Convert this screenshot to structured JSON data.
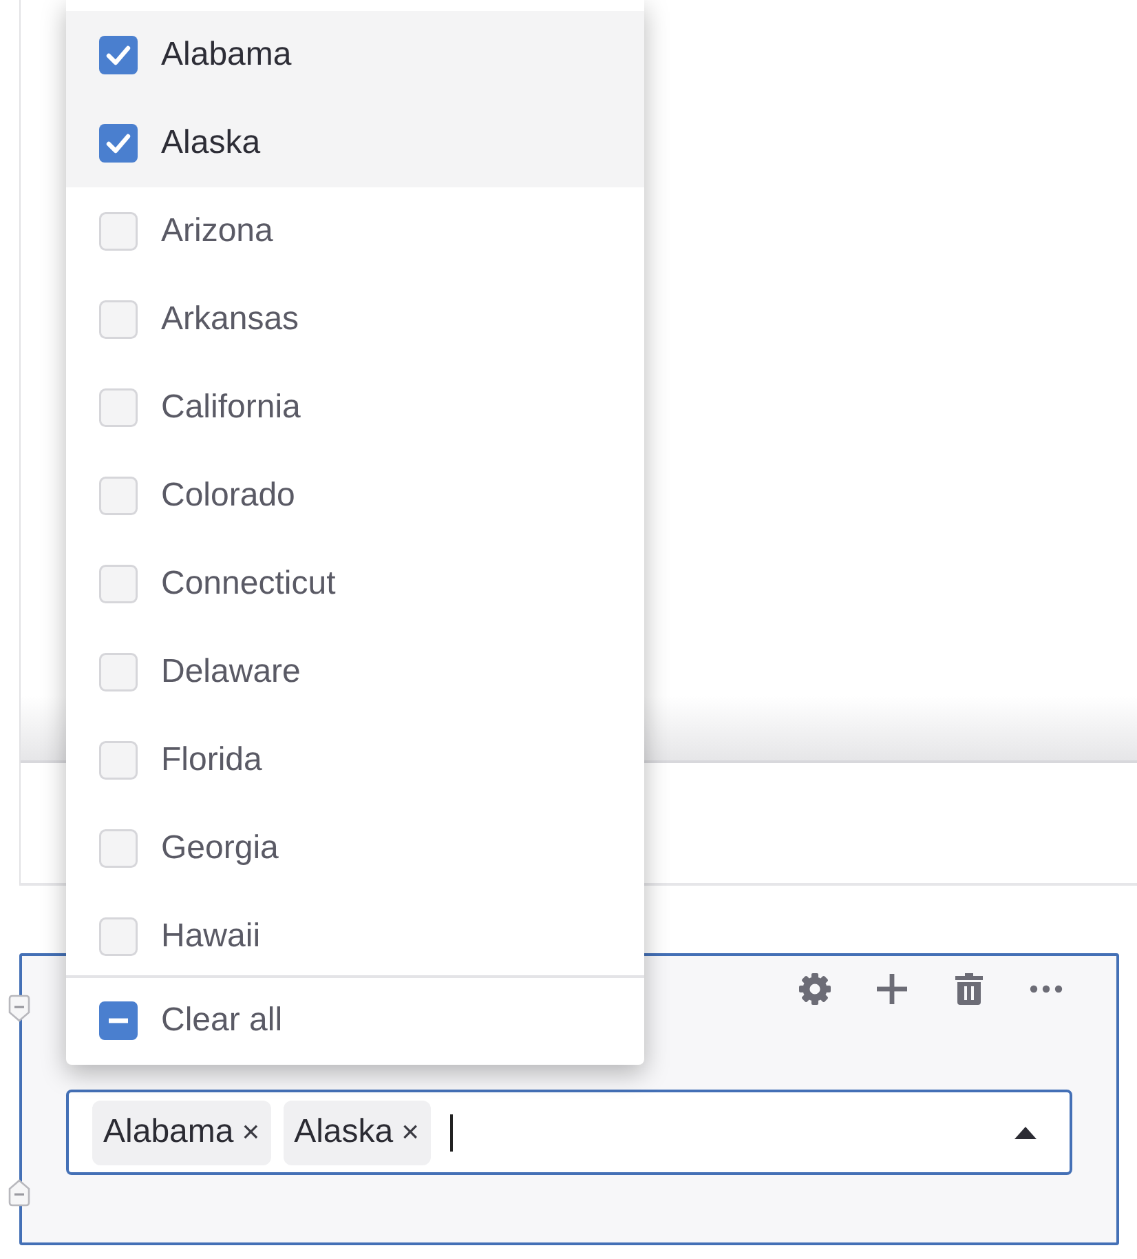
{
  "dropdown": {
    "options": [
      {
        "label": "Alabama",
        "checked": true
      },
      {
        "label": "Alaska",
        "checked": true
      },
      {
        "label": "Arizona",
        "checked": false
      },
      {
        "label": "Arkansas",
        "checked": false
      },
      {
        "label": "California",
        "checked": false
      },
      {
        "label": "Colorado",
        "checked": false
      },
      {
        "label": "Connecticut",
        "checked": false
      },
      {
        "label": "Delaware",
        "checked": false
      },
      {
        "label": "Florida",
        "checked": false
      },
      {
        "label": "Georgia",
        "checked": false
      },
      {
        "label": "Hawaii",
        "checked": false
      }
    ],
    "clear_all": {
      "label": "Clear all",
      "indeterminate": true
    }
  },
  "multiselect": {
    "tags": [
      {
        "label": "Alabama",
        "remove": "×"
      },
      {
        "label": "Alaska",
        "remove": "×"
      }
    ],
    "expanded": true
  }
}
